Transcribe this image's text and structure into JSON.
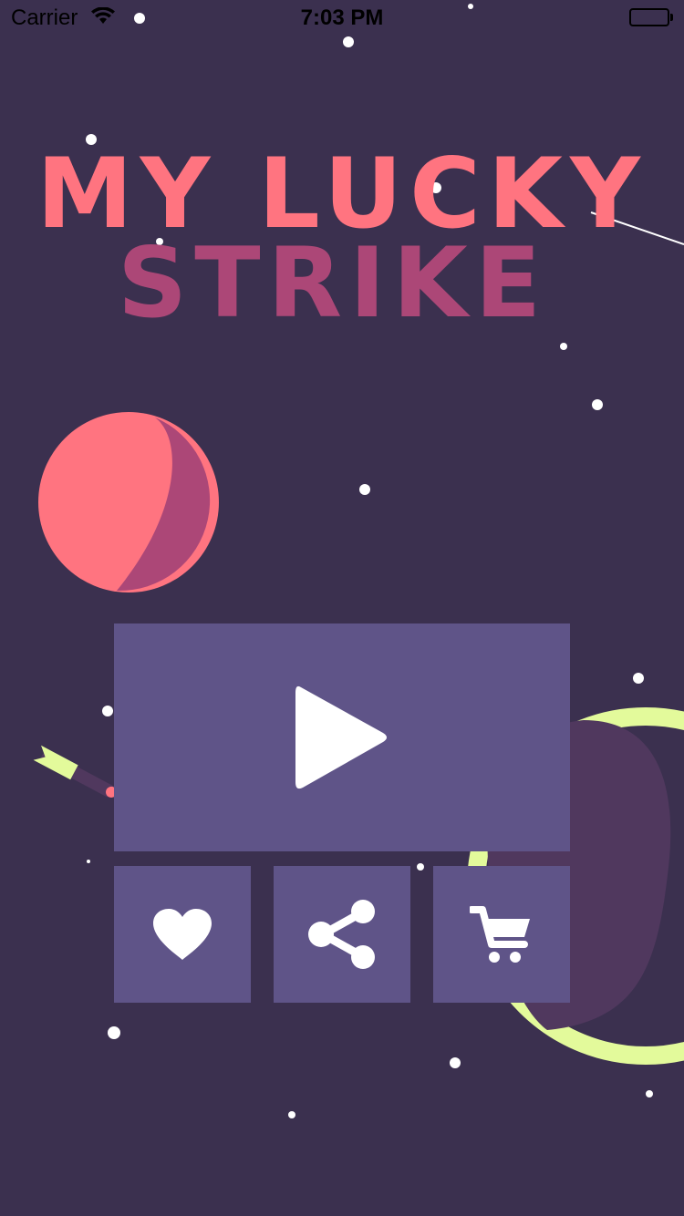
{
  "status_bar": {
    "carrier": "Carrier",
    "time": "7:03 PM"
  },
  "title": {
    "line1": "MY LUCKY",
    "line2": "STRIKE"
  },
  "menu": {
    "play_icon": "play-icon",
    "like_icon": "heart-icon",
    "share_icon": "share-icon",
    "shop_icon": "cart-icon"
  },
  "colors": {
    "background": "#3b304f",
    "title_primary": "#ff7480",
    "title_secondary": "#ac4777",
    "button": "#5f5488",
    "ring": "#e3fa9b",
    "icon": "#ffffff"
  }
}
